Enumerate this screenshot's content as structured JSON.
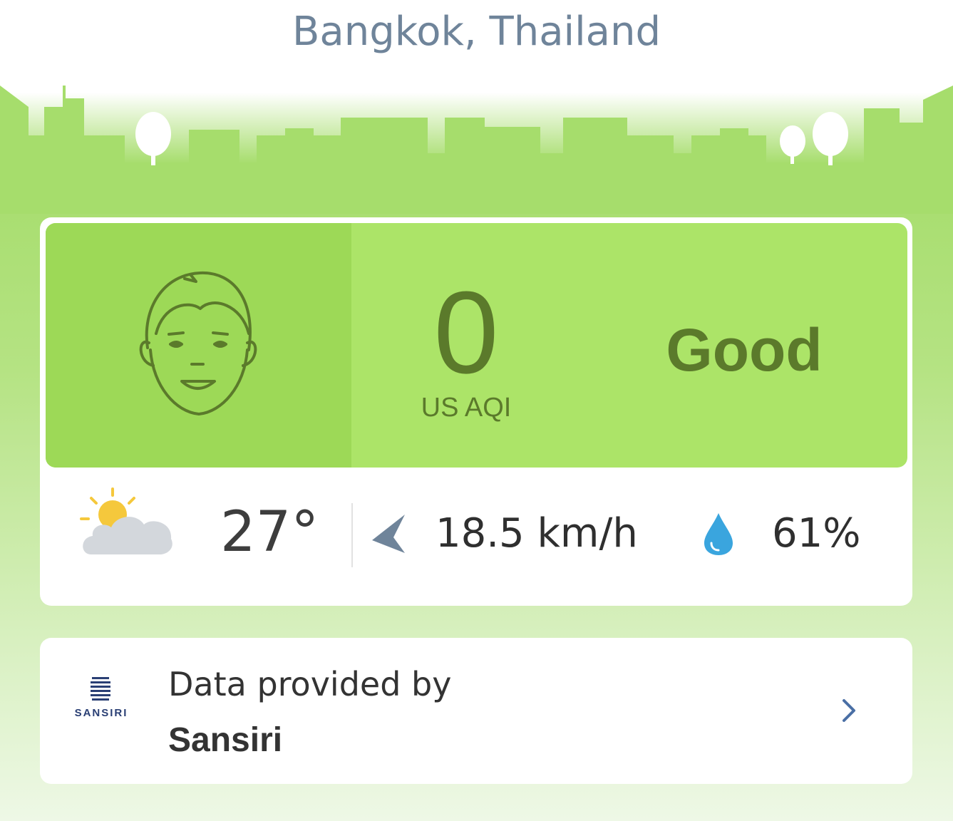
{
  "header": {
    "location": "Bangkok, Thailand"
  },
  "aqi": {
    "value": "0",
    "unit": "US AQI",
    "level": "Good",
    "face_icon": "happy-face-icon",
    "color": "#ace468"
  },
  "weather": {
    "condition_icon": "partly-cloudy-icon",
    "temperature": "27°",
    "wind_icon": "wind-direction-arrow-icon",
    "wind_speed": "18.5 km/h",
    "humidity_icon": "water-drop-icon",
    "humidity": "61%"
  },
  "provider": {
    "label": "Data provided by",
    "name": "Sansiri",
    "logo_text": "SANSIRI",
    "chevron_icon": "chevron-right-icon"
  }
}
